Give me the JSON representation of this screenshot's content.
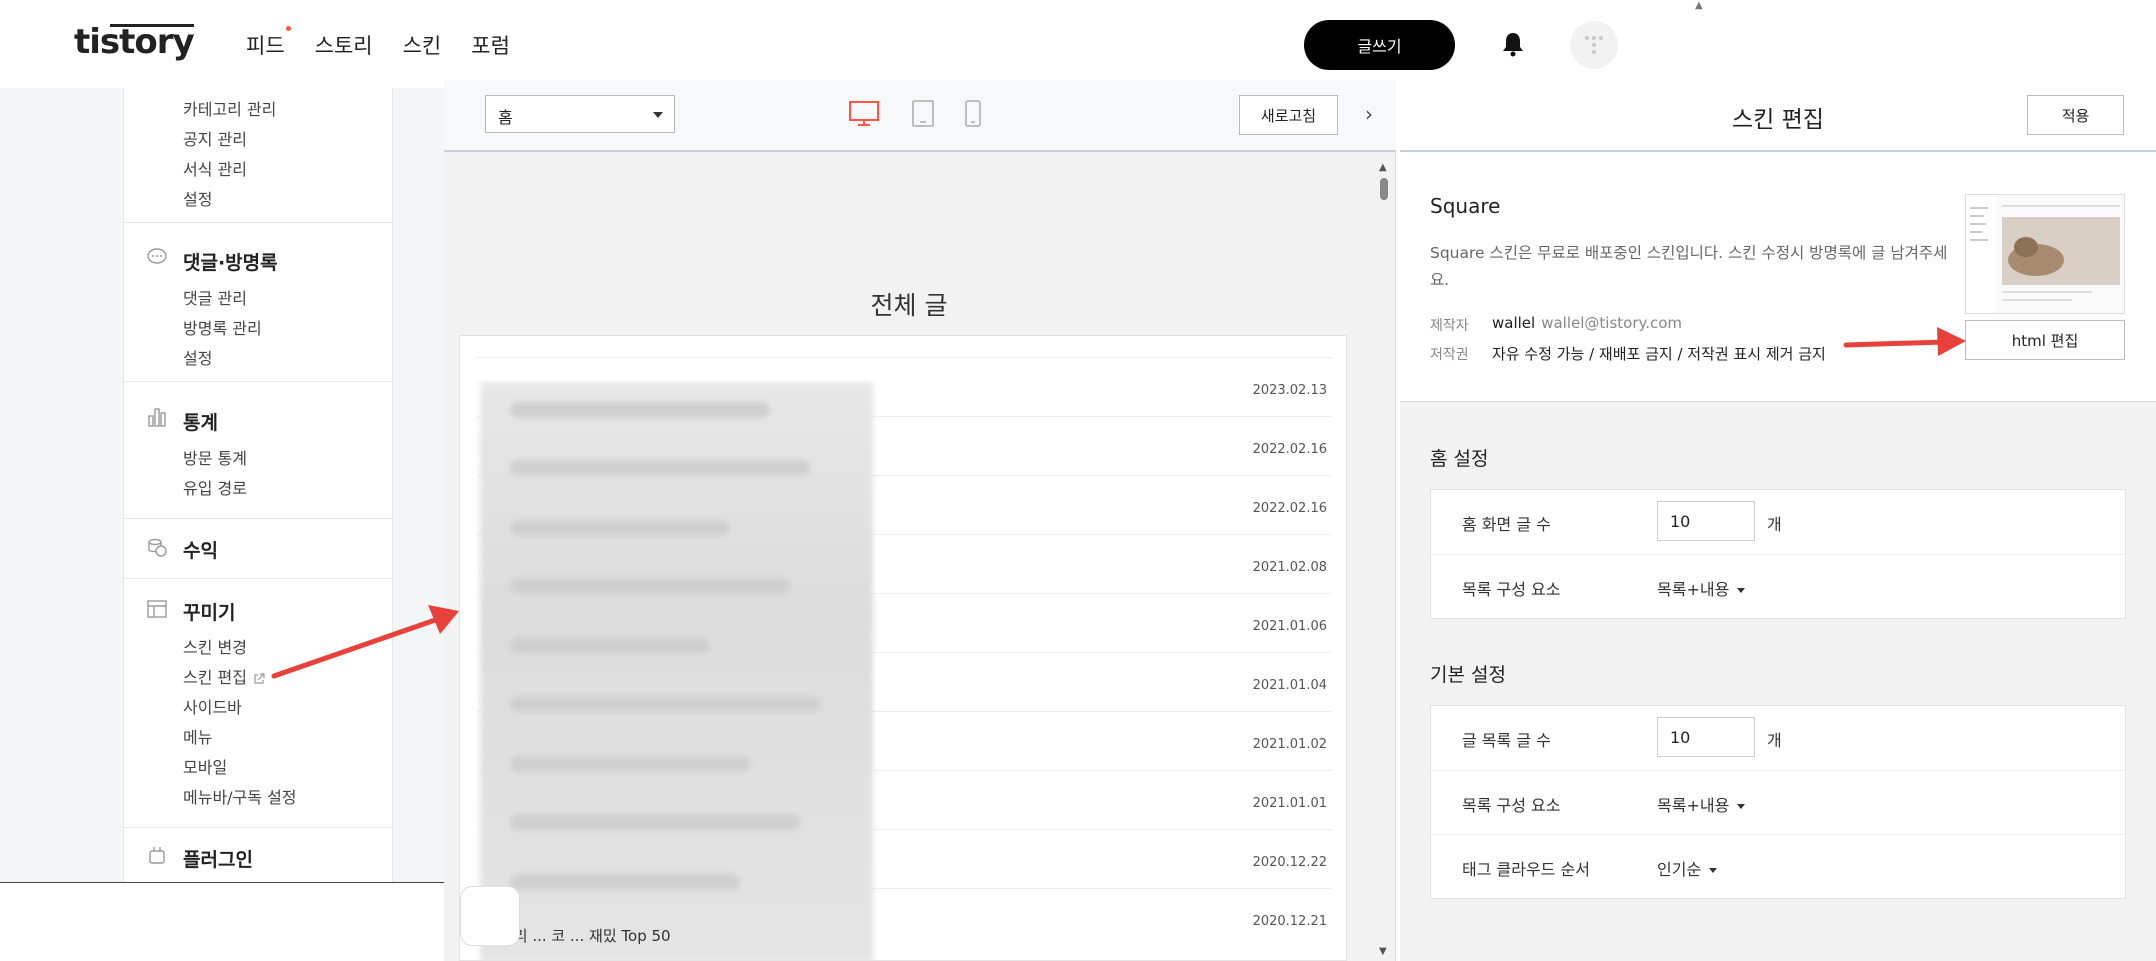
{
  "colors": {
    "accent": "#ff5544",
    "arrow": "#e8403a",
    "dark": "#000000",
    "desktop_active": "#ff5544"
  },
  "header": {
    "logo": "tistory",
    "nav": [
      "피드",
      "스토리",
      "스킨",
      "포럼"
    ],
    "write_label": "글쓰기",
    "icons": [
      "bell-icon",
      "profile-avatar"
    ]
  },
  "sidebar": {
    "top_items": [
      "카테고리 관리",
      "공지 관리",
      "서식 관리",
      "설정"
    ],
    "sections": [
      {
        "icon": "comment-icon",
        "title": "댓글·방명록",
        "items": [
          "댓글 관리",
          "방명록 관리",
          "설정"
        ]
      },
      {
        "icon": "stats-icon",
        "title": "통계",
        "items": [
          "방문 통계",
          "유입 경로"
        ]
      },
      {
        "icon": "coins-icon",
        "title": "수익",
        "items": []
      },
      {
        "icon": "layout-icon",
        "title": "꾸미기",
        "items": [
          "스킨 변경",
          "스킨 편집",
          "사이드바",
          "메뉴",
          "모바일",
          "메뉴바/구독 설정"
        ]
      },
      {
        "icon": "plugin-icon",
        "title": "플러그인",
        "items": []
      }
    ]
  },
  "preview": {
    "page_select": "홈",
    "refresh_label": "새로고침",
    "device_icons": [
      "desktop-icon",
      "tablet-icon",
      "mobile-icon"
    ],
    "title": "전체 글",
    "dates": [
      "2023.02.13",
      "2022.02.16",
      "2022.02.16",
      "2021.02.08",
      "2021.01.06",
      "2021.01.04",
      "2021.01.02",
      "2021.01.01",
      "2020.12.22",
      "2020.12.21"
    ],
    "last_row_text": "— 리 ... 코 ... 재밌 Top 50"
  },
  "editor": {
    "title": "스킨 편집",
    "apply_label": "적용",
    "skin_name": "Square",
    "skin_desc": "Square 스킨은 무료로 배포중인 스킨입니다. 스킨 수정시 방명록에 글 남겨주세요.",
    "maker_label": "제작자",
    "maker_name": "wallel",
    "maker_email": "wallel@tistory.com",
    "copyright_label": "저작권",
    "copyright_value": "자유 수정 가능 / 재배포 금지 / 저작권 표시 제거 금지",
    "html_edit_label": "html 편집",
    "home_settings": {
      "title": "홈 설정",
      "post_count_label": "홈 화면 글 수",
      "post_count_value": "10",
      "unit": "개",
      "list_elements_label": "목록 구성 요소",
      "list_elements_value": "목록+내용"
    },
    "basic_settings": {
      "title": "기본 설정",
      "list_count_label": "글 목록 글 수",
      "list_count_value": "10",
      "unit": "개",
      "list_elements_label": "목록 구성 요소",
      "list_elements_value": "목록+내용",
      "tag_order_label": "태그 클라우드 순서",
      "tag_order_value": "인기순"
    }
  }
}
